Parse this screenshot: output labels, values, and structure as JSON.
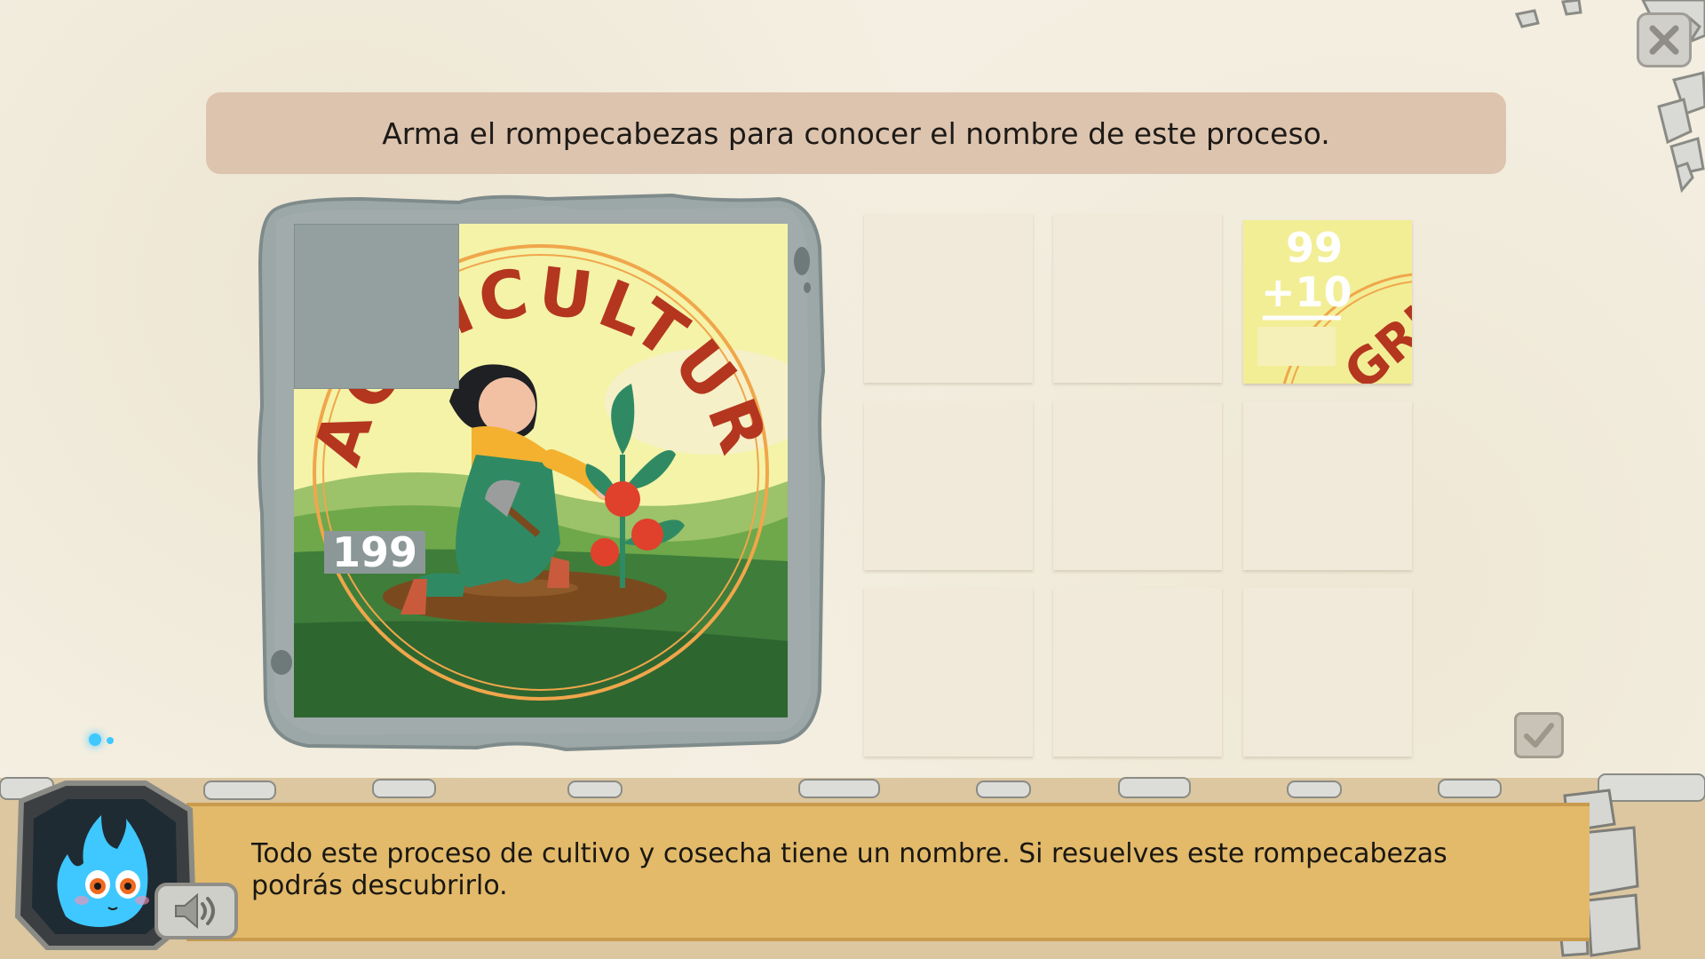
{
  "instruction": {
    "text": "Arma el rompecabezas para conocer el nombre de este proceso."
  },
  "reference": {
    "missing_piece_number": "199",
    "image_title": "AGRICULTURA"
  },
  "puzzle_grid": {
    "rows": 3,
    "cols": 3,
    "placed_piece": {
      "operand_top": "99",
      "operand_bottom": "+10",
      "fragment_text": "GRI"
    }
  },
  "dialog": {
    "text": "Todo este proceso de cultivo y cosecha tiene un nombre. Si resuelves este rompecabezas podrás descubrirlo."
  },
  "controls": {
    "check_icon": "checkmark-icon",
    "close_icon": "close-icon",
    "sound_icon": "speaker-icon"
  },
  "colors": {
    "instruction_bg": "#ddc4ae",
    "dialog_bg": "#e2ba6a",
    "stone": "#9aa5a5",
    "mascot": "#3fc8ff"
  }
}
